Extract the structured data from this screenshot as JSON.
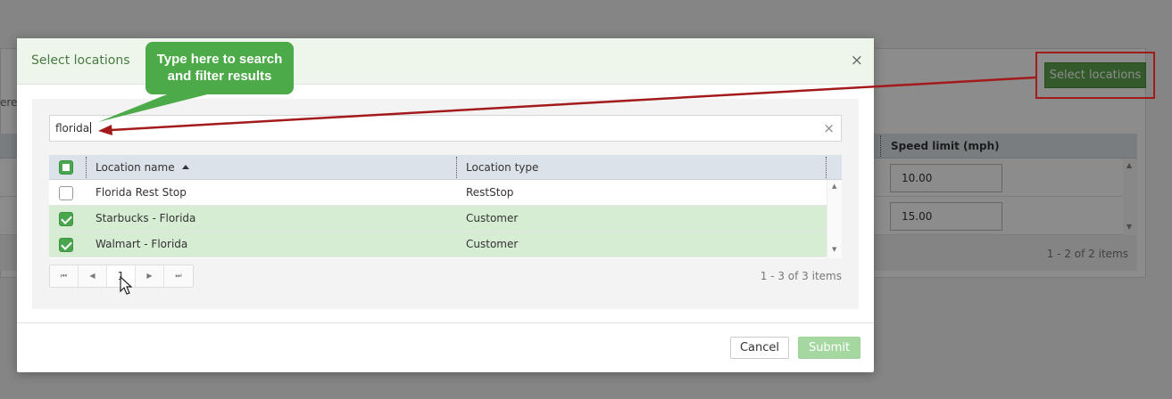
{
  "background": {
    "partial_text": "ere",
    "column_header": "Speed limit (mph)",
    "rows": [
      {
        "speed": "10.00"
      },
      {
        "speed": "15.00"
      }
    ],
    "footer_info": "1 - 2 of 2 items",
    "select_button": "Select locations"
  },
  "modal": {
    "title": "Select locations",
    "close_glyph": "×",
    "search": {
      "value": "florida",
      "clear_glyph": "×"
    },
    "grid": {
      "columns": [
        "Location name",
        "Location type"
      ],
      "rows": [
        {
          "name": "Florida Rest Stop",
          "type": "RestStop",
          "checked": false
        },
        {
          "name": "Starbucks - Florida",
          "type": "Customer",
          "checked": true
        },
        {
          "name": "Walmart - Florida",
          "type": "Customer",
          "checked": true
        }
      ]
    },
    "pager": {
      "first_glyph": "⏮",
      "prev_glyph": "◀",
      "page": "1",
      "next_glyph": "▶",
      "last_glyph": "⏭",
      "info": "1 - 3 of 3 items"
    },
    "footer": {
      "cancel": "Cancel",
      "submit": "Submit"
    }
  },
  "annotation": {
    "callout_line1": "Type here to search",
    "callout_line2": "and filter results",
    "colors": {
      "callout": "#4caa49",
      "arrow": "#a31a1a"
    }
  }
}
